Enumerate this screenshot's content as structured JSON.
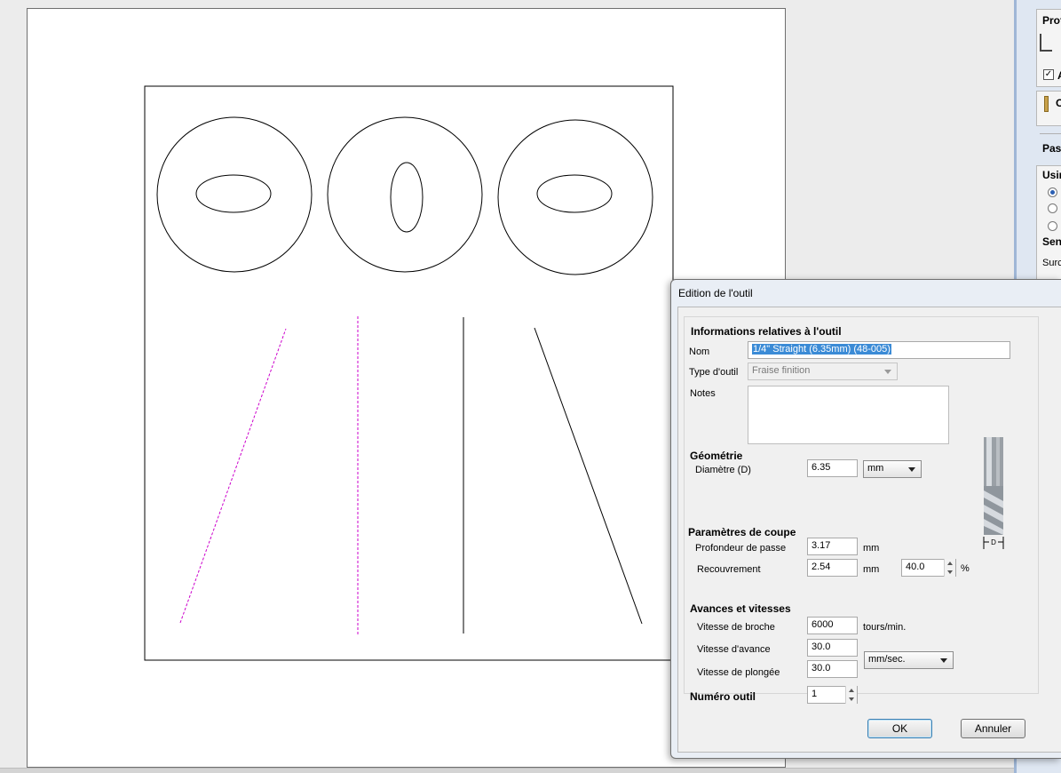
{
  "side_panel": {
    "profile_label": "Profi",
    "check_a_label": "A",
    "tool_label": "O",
    "passes_label": "Pass",
    "machining_label": "Usin",
    "direction_label": "Sens",
    "offset_label": "Surco"
  },
  "dialog": {
    "title": "Edition de l'outil",
    "section_info": "Informations relatives à l'outil",
    "name_label": "Nom",
    "name_value": "1/4\" Straight (6.35mm)  (48-005)",
    "tool_type_label": "Type d'outil",
    "tool_type_value": "Fraise finition",
    "notes_label": "Notes",
    "notes_value": "",
    "section_geometry": "Géométrie",
    "diameter_label": "Diamètre (D)",
    "diameter_value": "6.35",
    "diameter_unit": "mm",
    "section_cutting": "Paramètres de coupe",
    "pass_depth_label": "Profondeur de passe",
    "pass_depth_value": "3.17",
    "pass_depth_unit": "mm",
    "stepover_label": "Recouvrement",
    "stepover_value": "2.54",
    "stepover_unit": "mm",
    "stepover_percent_value": "40.0",
    "percent_symbol": "%",
    "section_feeds": "Avances et vitesses",
    "spindle_label": "Vitesse de broche",
    "spindle_value": "6000",
    "spindle_unit": "tours/min.",
    "feed_label": "Vitesse d'avance",
    "feed_value": "30.0",
    "plunge_label": "Vitesse de plongée",
    "plunge_value": "30.0",
    "rate_unit": "mm/sec.",
    "tool_number_label": "Numéro outil",
    "tool_number_value": "1",
    "diagram_label": "D",
    "ok_label": "OK",
    "cancel_label": "Annuler"
  },
  "colors": {
    "selected_path": "#cc00cc",
    "vector_stroke": "#000000",
    "selection_highlight": "#3b8bd6"
  }
}
